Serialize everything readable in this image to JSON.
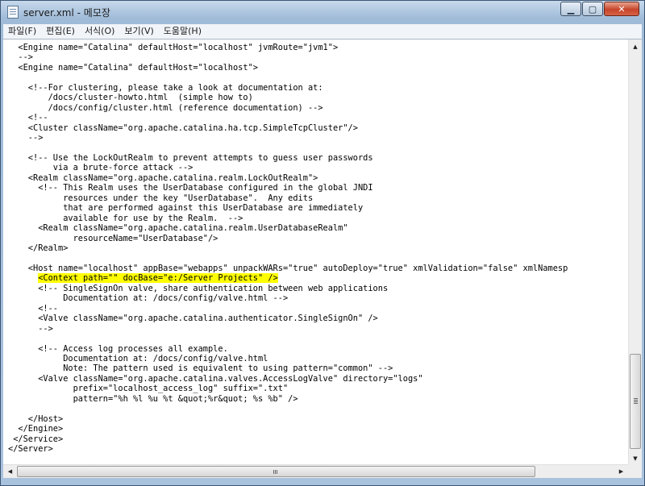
{
  "window": {
    "title": "server.xml - 메모장"
  },
  "menu": {
    "file": "파일(F)",
    "edit": "편집(E)",
    "format": "서식(O)",
    "view": "보기(V)",
    "help": "도움말(H)"
  },
  "editor": {
    "lines": [
      "  <Engine name=\"Catalina\" defaultHost=\"localhost\" jvmRoute=\"jvm1\">",
      "  -->",
      "  <Engine name=\"Catalina\" defaultHost=\"localhost\">",
      "",
      "    <!--For clustering, please take a look at documentation at:",
      "        /docs/cluster-howto.html  (simple how to)",
      "        /docs/config/cluster.html (reference documentation) -->",
      "    <!--",
      "    <Cluster className=\"org.apache.catalina.ha.tcp.SimpleTcpCluster\"/>",
      "    -->",
      "",
      "    <!-- Use the LockOutRealm to prevent attempts to guess user passwords",
      "         via a brute-force attack -->",
      "    <Realm className=\"org.apache.catalina.realm.LockOutRealm\">",
      "      <!-- This Realm uses the UserDatabase configured in the global JNDI",
      "           resources under the key \"UserDatabase\".  Any edits",
      "           that are performed against this UserDatabase are immediately",
      "           available for use by the Realm.  -->",
      "      <Realm className=\"org.apache.catalina.realm.UserDatabaseRealm\"",
      "             resourceName=\"UserDatabase\"/>",
      "    </Realm>",
      "",
      "    <Host name=\"localhost\" appBase=\"webapps\" unpackWARs=\"true\" autoDeploy=\"true\" xmlValidation=\"false\" xmlNamesp",
      "      <Context path=\"\" docBase=\"e:/Server Projects\" />",
      "      <!-- SingleSignOn valve, share authentication between web applications",
      "           Documentation at: /docs/config/valve.html -->",
      "      <!--",
      "      <Valve className=\"org.apache.catalina.authenticator.SingleSignOn\" />",
      "      -->",
      "",
      "      <!-- Access log processes all example.",
      "           Documentation at: /docs/config/valve.html",
      "           Note: The pattern used is equivalent to using pattern=\"common\" -->",
      "      <Valve className=\"org.apache.catalina.valves.AccessLogValve\" directory=\"logs\"",
      "             prefix=\"localhost_access_log\" suffix=\".txt\"",
      "             pattern=\"%h %l %u %t &quot;%r&quot; %s %b\" />",
      "",
      "    </Host>",
      "  </Engine>",
      " </Service>",
      "</Server>"
    ],
    "highlighted_line": 23,
    "highlight_color": "#ffff00"
  },
  "scrollbar": {
    "h_grip": "III"
  },
  "icons": {
    "app": "notepad-icon",
    "minimize": "minimize-icon",
    "maximize": "maximize-icon",
    "close": "close-icon"
  }
}
